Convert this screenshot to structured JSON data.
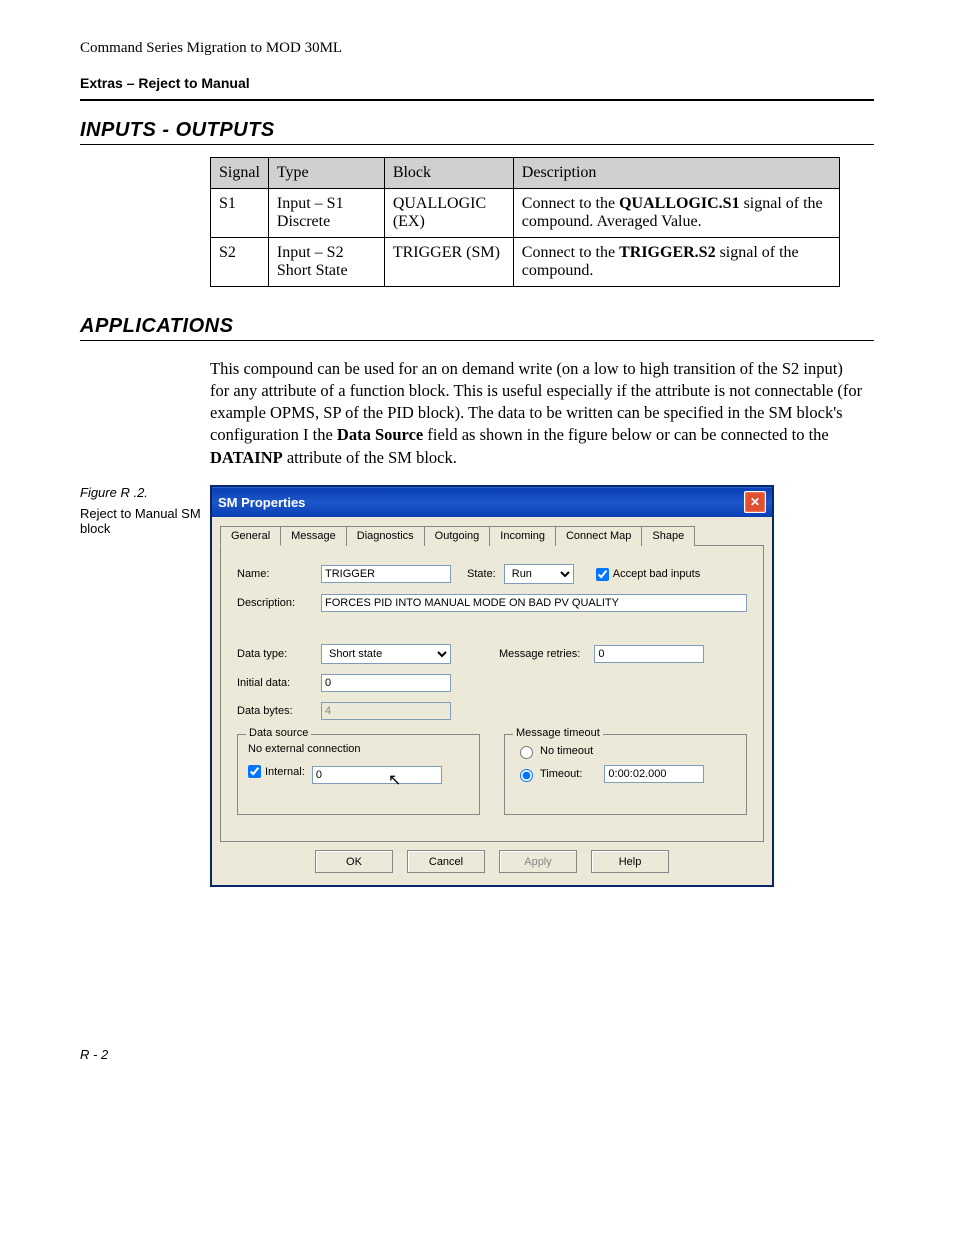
{
  "doc": {
    "header": "Command Series Migration to MOD 30ML",
    "subheader": "Extras – Reject to Manual",
    "footer": "R - 2"
  },
  "sections": {
    "io_title": "INPUTS - OUTPUTS",
    "apps_title": "APPLICATIONS"
  },
  "io_table": {
    "headers": [
      "Signal",
      "Type",
      "Block",
      "Description"
    ],
    "rows": [
      {
        "signal": "S1",
        "type": "Input – S1 Discrete",
        "block": "QUALLOGIC (EX)",
        "desc_pre": "Connect to the ",
        "desc_bold": "QUALLOGIC.S1",
        "desc_post": " signal of the compound. Averaged Value."
      },
      {
        "signal": "S2",
        "type": "Input – S2 Short State",
        "block": "TRIGGER (SM)",
        "desc_pre": "Connect to the ",
        "desc_bold": "TRIGGER.S2",
        "desc_post": " signal of the compound."
      }
    ]
  },
  "applications": {
    "p1a": "This compound can be used for an on demand write (on a low to high transition of the S2 input) for any attribute of a function block. This is useful especially if the attribute is not connectable (for example OPMS, SP of the PID block). The data to be written can be specified in the SM block's configuration I the ",
    "p1b": "Data Source",
    "p1c": " field as shown in the figure below or can be connected to the ",
    "p1d": "DATAINP",
    "p1e": " attribute of the SM block."
  },
  "figure": {
    "number": "Figure R .2.",
    "caption": "Reject to Manual SM block"
  },
  "dialog": {
    "title": "SM Properties",
    "tabs": [
      "General",
      "Message",
      "Diagnostics",
      "Outgoing",
      "Incoming",
      "Connect Map",
      "Shape"
    ],
    "labels": {
      "name": "Name:",
      "state": "State:",
      "accept_bad": "Accept bad inputs",
      "description": "Description:",
      "data_type": "Data type:",
      "message_retries": "Message retries:",
      "initial_data": "Initial data:",
      "data_bytes": "Data bytes:",
      "data_source": "Data source",
      "no_ext": "No external connection",
      "internal": "Internal:",
      "msg_timeout": "Message timeout",
      "no_timeout": "No timeout",
      "timeout": "Timeout:"
    },
    "values": {
      "name": "TRIGGER",
      "state": "Run",
      "accept_bad_checked": true,
      "description": "FORCES PID INTO MANUAL MODE ON BAD PV QUALITY",
      "data_type": "Short state",
      "message_retries": "0",
      "initial_data": "0",
      "data_bytes": "4",
      "internal_checked": true,
      "internal_value": "0",
      "timeout_selected": "timeout",
      "timeout_value": "0:00:02.000"
    },
    "buttons": {
      "ok": "OK",
      "cancel": "Cancel",
      "apply": "Apply",
      "help": "Help"
    }
  }
}
